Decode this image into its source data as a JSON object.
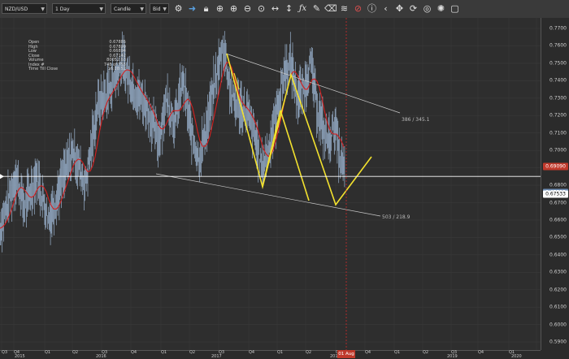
{
  "toolbar": {
    "symbol": "NZD/USD",
    "period": "1 Day",
    "chart_type": "Candle",
    "price_side": "Bid",
    "icons": [
      "gear-icon",
      "arrow-right-icon",
      "lock-icon",
      "crosshair-icon",
      "zoom-in-icon",
      "zoom-out-icon",
      "zoom-fit-icon",
      "horizontal-resize-icon",
      "vertical-resize-icon",
      "fx-icon",
      "pencil-icon",
      "eraser-icon",
      "layers-icon",
      "ban-icon",
      "info-icon",
      "chevron-left-icon",
      "pan-icon",
      "refresh-icon",
      "target-icon",
      "maximize-icon"
    ]
  },
  "info_panel": [
    {
      "label": "Open",
      "value": "0.67885"
    },
    {
      "label": "High",
      "value": "0.67899"
    },
    {
      "label": "Low",
      "value": "0.66894"
    },
    {
      "label": "Close",
      "value": "0.67142"
    },
    {
      "label": "Volume",
      "value": "80052.63"
    },
    {
      "label": "Index #",
      "value": "748 of 755"
    },
    {
      "label": "Time Till Close",
      "value": "16:28:52"
    }
  ],
  "price_axis": [
    "0.7700",
    "0.7600",
    "0.7500",
    "0.7400",
    "0.7300",
    "0.7200",
    "0.7100",
    "0.7000",
    "0.6900",
    "0.6800",
    "0.6700",
    "0.6600",
    "0.6500",
    "0.6400",
    "0.6300",
    "0.6200",
    "0.6100",
    "0.6000",
    "0.5900"
  ],
  "price_tags": {
    "ma_value": "0.69090",
    "last_price": "0.67533",
    "crosshair_price": "0.67533"
  },
  "annotations": {
    "upper_channel": "386 / 345.1",
    "lower_channel": "503 / 218.9"
  },
  "time_axis": {
    "quarters": [
      "Q3",
      "Q4",
      "Q1",
      "Q2",
      "Q3",
      "Q4",
      "Q1",
      "Q2",
      "Q3",
      "Q4",
      "Q1",
      "Q2",
      "Q3",
      "Q4",
      "Q1",
      "Q2",
      "Q3",
      "Q4",
      "Q1",
      "Q2",
      "Q3",
      "Q4",
      "Q1"
    ],
    "years": [
      "2015",
      "2016",
      "2017",
      "2018",
      "2019",
      "2020"
    ],
    "cursor_date": "01 Aug"
  },
  "colors": {
    "moving_average": "#d42020",
    "pattern": "#f2e12e",
    "channel": "#c8c8c8",
    "price": "#9bb3cf",
    "cursor": "#cc2a2a"
  }
}
